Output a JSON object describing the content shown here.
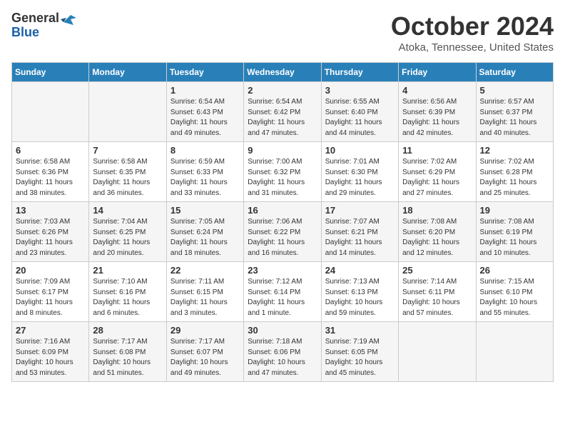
{
  "header": {
    "logo_general": "General",
    "logo_blue": "Blue",
    "month_title": "October 2024",
    "location": "Atoka, Tennessee, United States"
  },
  "weekdays": [
    "Sunday",
    "Monday",
    "Tuesday",
    "Wednesday",
    "Thursday",
    "Friday",
    "Saturday"
  ],
  "weeks": [
    [
      {
        "day": "",
        "sunrise": "",
        "sunset": "",
        "daylight": ""
      },
      {
        "day": "",
        "sunrise": "",
        "sunset": "",
        "daylight": ""
      },
      {
        "day": "1",
        "sunrise": "Sunrise: 6:54 AM",
        "sunset": "Sunset: 6:43 PM",
        "daylight": "Daylight: 11 hours and 49 minutes."
      },
      {
        "day": "2",
        "sunrise": "Sunrise: 6:54 AM",
        "sunset": "Sunset: 6:42 PM",
        "daylight": "Daylight: 11 hours and 47 minutes."
      },
      {
        "day": "3",
        "sunrise": "Sunrise: 6:55 AM",
        "sunset": "Sunset: 6:40 PM",
        "daylight": "Daylight: 11 hours and 44 minutes."
      },
      {
        "day": "4",
        "sunrise": "Sunrise: 6:56 AM",
        "sunset": "Sunset: 6:39 PM",
        "daylight": "Daylight: 11 hours and 42 minutes."
      },
      {
        "day": "5",
        "sunrise": "Sunrise: 6:57 AM",
        "sunset": "Sunset: 6:37 PM",
        "daylight": "Daylight: 11 hours and 40 minutes."
      }
    ],
    [
      {
        "day": "6",
        "sunrise": "Sunrise: 6:58 AM",
        "sunset": "Sunset: 6:36 PM",
        "daylight": "Daylight: 11 hours and 38 minutes."
      },
      {
        "day": "7",
        "sunrise": "Sunrise: 6:58 AM",
        "sunset": "Sunset: 6:35 PM",
        "daylight": "Daylight: 11 hours and 36 minutes."
      },
      {
        "day": "8",
        "sunrise": "Sunrise: 6:59 AM",
        "sunset": "Sunset: 6:33 PM",
        "daylight": "Daylight: 11 hours and 33 minutes."
      },
      {
        "day": "9",
        "sunrise": "Sunrise: 7:00 AM",
        "sunset": "Sunset: 6:32 PM",
        "daylight": "Daylight: 11 hours and 31 minutes."
      },
      {
        "day": "10",
        "sunrise": "Sunrise: 7:01 AM",
        "sunset": "Sunset: 6:30 PM",
        "daylight": "Daylight: 11 hours and 29 minutes."
      },
      {
        "day": "11",
        "sunrise": "Sunrise: 7:02 AM",
        "sunset": "Sunset: 6:29 PM",
        "daylight": "Daylight: 11 hours and 27 minutes."
      },
      {
        "day": "12",
        "sunrise": "Sunrise: 7:02 AM",
        "sunset": "Sunset: 6:28 PM",
        "daylight": "Daylight: 11 hours and 25 minutes."
      }
    ],
    [
      {
        "day": "13",
        "sunrise": "Sunrise: 7:03 AM",
        "sunset": "Sunset: 6:26 PM",
        "daylight": "Daylight: 11 hours and 23 minutes."
      },
      {
        "day": "14",
        "sunrise": "Sunrise: 7:04 AM",
        "sunset": "Sunset: 6:25 PM",
        "daylight": "Daylight: 11 hours and 20 minutes."
      },
      {
        "day": "15",
        "sunrise": "Sunrise: 7:05 AM",
        "sunset": "Sunset: 6:24 PM",
        "daylight": "Daylight: 11 hours and 18 minutes."
      },
      {
        "day": "16",
        "sunrise": "Sunrise: 7:06 AM",
        "sunset": "Sunset: 6:22 PM",
        "daylight": "Daylight: 11 hours and 16 minutes."
      },
      {
        "day": "17",
        "sunrise": "Sunrise: 7:07 AM",
        "sunset": "Sunset: 6:21 PM",
        "daylight": "Daylight: 11 hours and 14 minutes."
      },
      {
        "day": "18",
        "sunrise": "Sunrise: 7:08 AM",
        "sunset": "Sunset: 6:20 PM",
        "daylight": "Daylight: 11 hours and 12 minutes."
      },
      {
        "day": "19",
        "sunrise": "Sunrise: 7:08 AM",
        "sunset": "Sunset: 6:19 PM",
        "daylight": "Daylight: 11 hours and 10 minutes."
      }
    ],
    [
      {
        "day": "20",
        "sunrise": "Sunrise: 7:09 AM",
        "sunset": "Sunset: 6:17 PM",
        "daylight": "Daylight: 11 hours and 8 minutes."
      },
      {
        "day": "21",
        "sunrise": "Sunrise: 7:10 AM",
        "sunset": "Sunset: 6:16 PM",
        "daylight": "Daylight: 11 hours and 6 minutes."
      },
      {
        "day": "22",
        "sunrise": "Sunrise: 7:11 AM",
        "sunset": "Sunset: 6:15 PM",
        "daylight": "Daylight: 11 hours and 3 minutes."
      },
      {
        "day": "23",
        "sunrise": "Sunrise: 7:12 AM",
        "sunset": "Sunset: 6:14 PM",
        "daylight": "Daylight: 11 hours and 1 minute."
      },
      {
        "day": "24",
        "sunrise": "Sunrise: 7:13 AM",
        "sunset": "Sunset: 6:13 PM",
        "daylight": "Daylight: 10 hours and 59 minutes."
      },
      {
        "day": "25",
        "sunrise": "Sunrise: 7:14 AM",
        "sunset": "Sunset: 6:11 PM",
        "daylight": "Daylight: 10 hours and 57 minutes."
      },
      {
        "day": "26",
        "sunrise": "Sunrise: 7:15 AM",
        "sunset": "Sunset: 6:10 PM",
        "daylight": "Daylight: 10 hours and 55 minutes."
      }
    ],
    [
      {
        "day": "27",
        "sunrise": "Sunrise: 7:16 AM",
        "sunset": "Sunset: 6:09 PM",
        "daylight": "Daylight: 10 hours and 53 minutes."
      },
      {
        "day": "28",
        "sunrise": "Sunrise: 7:17 AM",
        "sunset": "Sunset: 6:08 PM",
        "daylight": "Daylight: 10 hours and 51 minutes."
      },
      {
        "day": "29",
        "sunrise": "Sunrise: 7:17 AM",
        "sunset": "Sunset: 6:07 PM",
        "daylight": "Daylight: 10 hours and 49 minutes."
      },
      {
        "day": "30",
        "sunrise": "Sunrise: 7:18 AM",
        "sunset": "Sunset: 6:06 PM",
        "daylight": "Daylight: 10 hours and 47 minutes."
      },
      {
        "day": "31",
        "sunrise": "Sunrise: 7:19 AM",
        "sunset": "Sunset: 6:05 PM",
        "daylight": "Daylight: 10 hours and 45 minutes."
      },
      {
        "day": "",
        "sunrise": "",
        "sunset": "",
        "daylight": ""
      },
      {
        "day": "",
        "sunrise": "",
        "sunset": "",
        "daylight": ""
      }
    ]
  ]
}
